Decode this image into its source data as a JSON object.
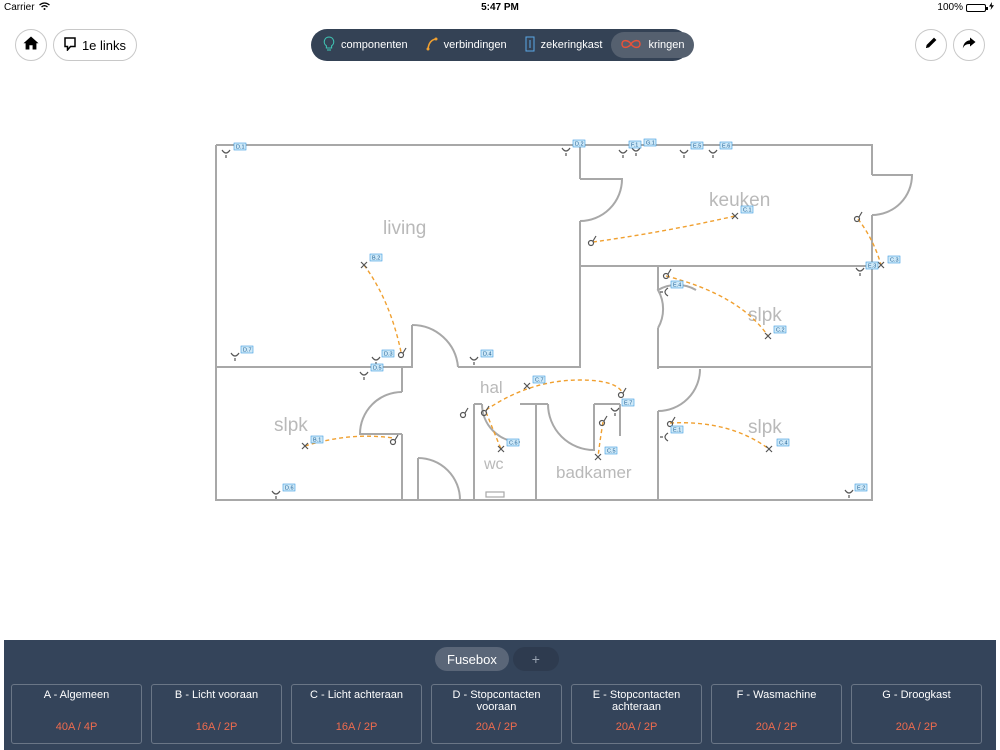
{
  "status": {
    "carrier": "Carrier",
    "time": "5:47 PM",
    "battery": "100%"
  },
  "toolbar": {
    "links_label": "1e links"
  },
  "modes": [
    {
      "label": "componenten",
      "icon": "lightbulb-icon",
      "active": false
    },
    {
      "label": "verbindingen",
      "icon": "wire-icon",
      "active": false
    },
    {
      "label": "zekeringkast",
      "icon": "fusebox-icon",
      "active": false
    },
    {
      "label": "kringen",
      "icon": "infinity-icon",
      "active": true
    }
  ],
  "rooms": [
    "living",
    "keuken",
    "slpk",
    "slpk",
    "hal",
    "slpk",
    "wc",
    "badkamer"
  ],
  "tags": [
    "D.1",
    "D.2",
    "F.1",
    "G.1",
    "E.5",
    "E.6",
    "C.1",
    "B.2",
    "C.3",
    "E.3",
    "E.4",
    "C.2",
    "D.7",
    "D.3",
    "D.5",
    "D.4",
    "C.7",
    "E.7",
    "B.1",
    "C.6",
    "C.5",
    "E.1",
    "C.4",
    "D.6",
    "E.2"
  ],
  "fusebox": {
    "tab_label": "Fusebox",
    "add_label": "+",
    "groups": [
      {
        "name": "A - Algemeen",
        "rating": "40A / 4P"
      },
      {
        "name": "B - Licht vooraan",
        "rating": "16A / 2P"
      },
      {
        "name": "C - Licht achteraan",
        "rating": "16A / 2P"
      },
      {
        "name": "D - Stopcontacten vooraan",
        "rating": "20A / 2P"
      },
      {
        "name": "E - Stopcontacten achteraan",
        "rating": "20A / 2P"
      },
      {
        "name": "F - Wasmachine",
        "rating": "20A / 2P"
      },
      {
        "name": "G - Droogkast",
        "rating": "20A / 2P"
      }
    ]
  },
  "colors": {
    "accent": "#f0a030",
    "active_mode": "#e8523a",
    "tag_fill": "#cfe9f8",
    "tag_stroke": "#3d9be0"
  }
}
